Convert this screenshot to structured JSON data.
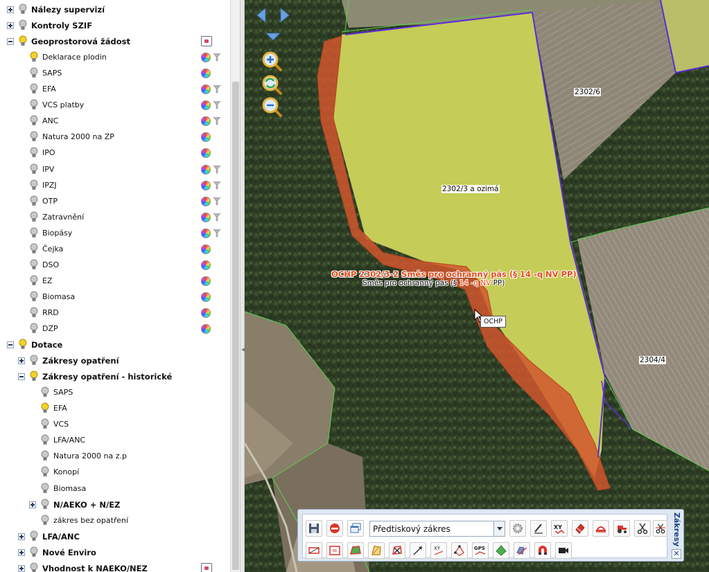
{
  "layer_tree": {
    "items": [
      {
        "label": "Nálezy supervizí",
        "level": 0,
        "group": true,
        "expander": "plus",
        "bulb": "grey"
      },
      {
        "label": "Kontroly SZIF",
        "level": 0,
        "group": true,
        "expander": "plus",
        "bulb": "grey"
      },
      {
        "label": "Geoprostorová žádost",
        "level": 0,
        "group": true,
        "expander": "minus",
        "bulb": "yellow",
        "group_icon": true
      },
      {
        "label": "Deklarace plodin",
        "level": 1,
        "bulb": "yellow",
        "wheel": true,
        "filter": true
      },
      {
        "label": "SAPS",
        "level": 1,
        "bulb": "grey",
        "wheel": true
      },
      {
        "label": "EFA",
        "level": 1,
        "bulb": "grey",
        "wheel": true,
        "filter": true
      },
      {
        "label": "VCS platby",
        "level": 1,
        "bulb": "grey",
        "wheel": true,
        "filter": true
      },
      {
        "label": "ANC",
        "level": 1,
        "bulb": "grey",
        "wheel": true,
        "filter": true
      },
      {
        "label": "Natura 2000 na ZP",
        "level": 1,
        "bulb": "grey",
        "wheel": true
      },
      {
        "label": "IPO",
        "level": 1,
        "bulb": "grey",
        "wheel": true
      },
      {
        "label": "IPV",
        "level": 1,
        "bulb": "grey",
        "wheel": true,
        "filter": true
      },
      {
        "label": "IPZJ",
        "level": 1,
        "bulb": "grey",
        "wheel": true,
        "filter": true
      },
      {
        "label": "OTP",
        "level": 1,
        "bulb": "grey",
        "wheel": true,
        "filter": true
      },
      {
        "label": "Zatravnění",
        "level": 1,
        "bulb": "grey",
        "wheel": true,
        "filter": true
      },
      {
        "label": "Biopásy",
        "level": 1,
        "bulb": "grey",
        "wheel": true,
        "filter": true
      },
      {
        "label": "Čejka",
        "level": 1,
        "bulb": "grey",
        "wheel": true
      },
      {
        "label": "DSO",
        "level": 1,
        "bulb": "grey",
        "wheel": true
      },
      {
        "label": "EZ",
        "level": 1,
        "bulb": "grey",
        "wheel": true
      },
      {
        "label": "Biomasa",
        "level": 1,
        "bulb": "grey",
        "wheel": true
      },
      {
        "label": "RRD",
        "level": 1,
        "bulb": "grey",
        "wheel": true
      },
      {
        "label": "DZP",
        "level": 1,
        "bulb": "grey",
        "wheel": true
      },
      {
        "label": "Dotace",
        "level": 0,
        "group": true,
        "expander": "minus",
        "bulb": "yellow"
      },
      {
        "label": "Zákresy opatření",
        "level": 1,
        "group": true,
        "expander": "plus",
        "bulb": "grey"
      },
      {
        "label": "Zákresy opatření - historické",
        "level": 1,
        "group": true,
        "expander": "minus",
        "bulb": "yellow"
      },
      {
        "label": "SAPS",
        "level": 2,
        "bulb": "grey"
      },
      {
        "label": "EFA",
        "level": 2,
        "bulb": "yellow"
      },
      {
        "label": "VCS",
        "level": 2,
        "bulb": "grey"
      },
      {
        "label": "LFA/ANC",
        "level": 2,
        "bulb": "grey"
      },
      {
        "label": "Natura 2000 na z.p",
        "level": 2,
        "bulb": "grey"
      },
      {
        "label": "Konopí",
        "level": 2,
        "bulb": "grey"
      },
      {
        "label": "Biomasa",
        "level": 2,
        "bulb": "grey"
      },
      {
        "label": "N/AEKO + N/EZ",
        "level": 2,
        "group": true,
        "expander": "plus",
        "bulb": "grey"
      },
      {
        "label": "zákres bez opatření",
        "level": 2,
        "bulb": "grey"
      },
      {
        "label": "LFA/ANC",
        "level": 1,
        "group": true,
        "expander": "plus",
        "bulb": "grey"
      },
      {
        "label": "Nové Enviro",
        "level": 1,
        "group": true,
        "expander": "plus",
        "bulb": "grey"
      },
      {
        "label": "Vhodnost k NAEKO/NEZ",
        "level": 1,
        "group": true,
        "expander": "plus",
        "bulb": "grey",
        "group_icon": true
      }
    ]
  },
  "map": {
    "parcel_labels": {
      "p1": "2302/6",
      "p2": "2302/3",
      "p2_crop": "a ozimá",
      "p3": "2304/4"
    },
    "ochp_label": "OCHP 2302/3-2 Směs pro ochranný pás (§ 14 -q NV PP)",
    "ochp_sublabel_a": "Směs pro ochranný pás (§ ",
    "ochp_sublabel_b": "14 -q NV",
    "ochp_sublabel_c": " PP)",
    "tooltip": "OCHP",
    "colors": {
      "field": "#c5cc58",
      "buffer_strip": "#d0562e",
      "parcel_border": "#5b2bd6",
      "block_border": "#5ad04e"
    }
  },
  "toolbar": {
    "title": "Zákresy",
    "select_value": "Předtiskový zákres",
    "close": "✕",
    "tool_xy": "XY",
    "tool_gps": "GPS"
  }
}
